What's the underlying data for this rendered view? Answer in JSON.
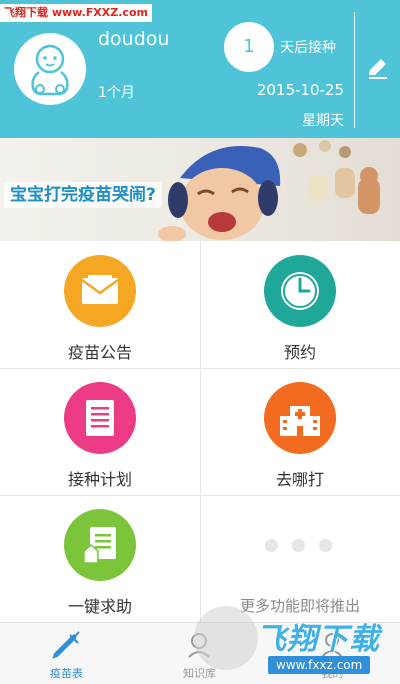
{
  "watermark_top": "飞翔下载 www.FXXZ.com",
  "profile": {
    "name": "doudou",
    "age": "1个月",
    "days_until_vaccine": "1",
    "days_label": "天后接种",
    "date": "2015-10-25",
    "weekday": "星期天"
  },
  "banner": {
    "headline": "宝宝打完疫苗哭闹?"
  },
  "features": [
    {
      "label": "疫苗公告",
      "icon": "envelope-icon",
      "color": "#f5a623"
    },
    {
      "label": "预约",
      "icon": "clock-icon",
      "color": "#1fa89a"
    },
    {
      "label": "接种计划",
      "icon": "document-icon",
      "color": "#ec3b84"
    },
    {
      "label": "去哪打",
      "icon": "hospital-icon",
      "color": "#f26b21"
    },
    {
      "label": "一键求助",
      "icon": "help-document-icon",
      "color": "#7cc43a"
    }
  ],
  "more_features": "更多功能即将推出",
  "tabs": [
    {
      "label": "疫苗表",
      "icon": "syringe-icon",
      "active": true
    },
    {
      "label": "知识库",
      "icon": "knowledge-icon",
      "active": false
    },
    {
      "label": "我的",
      "icon": "user-icon",
      "active": false
    }
  ],
  "watermark": {
    "title": "飞翔下载",
    "url": "www.fxxz.com"
  },
  "colors": {
    "header_bg": "#4fc4d8",
    "tab_active": "#2f8fd8"
  }
}
